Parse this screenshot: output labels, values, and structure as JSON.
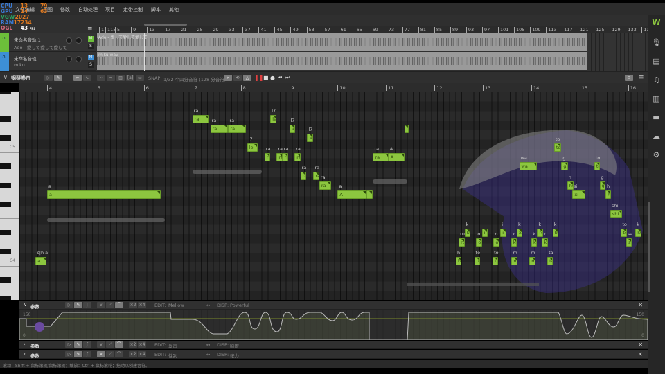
{
  "menu": [
    "文件",
    "编辑",
    "视图",
    "修改",
    "自动处理",
    "项目",
    "走带控制",
    "脚本",
    "其他"
  ],
  "stats": {
    "cpu_label": "CPU",
    "cpu": "13",
    "cpu_temp": "79",
    "gpu_label": "GPU",
    "gpu": "14",
    "gpu_temp": "63",
    "vram_label": "VGW",
    "vram": "2027",
    "ram_label": "RAM",
    "ram": "17234",
    "ogl_label": "OGL",
    "fps": "43",
    "fps_unit": "FPS"
  },
  "arrangement": {
    "ruler": [
      "1",
      "115",
      "5",
      "9",
      "13",
      "17",
      "21",
      "25",
      "29",
      "33",
      "37",
      "41",
      "45",
      "49",
      "53",
      "57",
      "61",
      "65",
      "69",
      "73",
      "77",
      "81",
      "85",
      "89",
      "93",
      "97",
      "101",
      "105",
      "109",
      "113",
      "117",
      "121",
      "125",
      "129",
      "133",
      "137"
    ],
    "tracks": [
      {
        "name": "未命名音轨 1",
        "sub": "Ado - 愛して愛して愛して",
        "clip": "Ado - 愛して愛して愛して",
        "color": "#6cbf3a",
        "mute": "M",
        "solo": "S"
      },
      {
        "name": "未命名音轨",
        "sub": "miku",
        "clip": "miku.wav",
        "color": "#3d8fd6",
        "mute": "M",
        "solo": "S"
      }
    ]
  },
  "piano_roll": {
    "title": "钢琴卷帘",
    "snap_label": "SNAP:",
    "snap_value": "1/32 个四分音符 (128 分音符)",
    "ruler": [
      "4",
      "5",
      "6",
      "7",
      "8",
      "9",
      "10",
      "11",
      "12",
      "13",
      "14",
      "15",
      "16"
    ],
    "key_labels": [
      "C5",
      "C4"
    ],
    "notes": [
      {
        "lyric": "a",
        "phoneme": "a",
        "bar": 4.0,
        "len": 2.34,
        "pitch": 67
      },
      {
        "lyric": "a",
        "phoneme": "c|h a",
        "bar": 3.76,
        "len": 0.23,
        "pitch": 60
      },
      {
        "lyric": "ra",
        "phoneme": "ra",
        "bar": 7.0,
        "len": 0.34,
        "pitch": 75
      },
      {
        "lyric": "ra",
        "phoneme": "ra",
        "bar": 7.37,
        "len": 0.37,
        "pitch": 74
      },
      {
        "lyric": "ra",
        "phoneme": "ra",
        "bar": 7.74,
        "len": 0.37,
        "pitch": 74
      },
      {
        "lyric": "le",
        "phoneme": "l7",
        "bar": 8.13,
        "len": 0.22,
        "pitch": 72
      },
      {
        "lyric": "ra",
        "phoneme": "ra",
        "bar": 8.49,
        "len": 0.12,
        "pitch": 71
      },
      {
        "lyric": "le",
        "phoneme": "l7",
        "bar": 8.61,
        "len": 0.12,
        "pitch": 75
      },
      {
        "lyric": "ra",
        "phoneme": "ra",
        "bar": 8.74,
        "len": 0.12,
        "pitch": 71
      },
      {
        "lyric": "ra",
        "phoneme": "ra",
        "bar": 8.86,
        "len": 0.12,
        "pitch": 71
      },
      {
        "lyric": "le",
        "phoneme": "l7",
        "bar": 9.0,
        "len": 0.12,
        "pitch": 74
      },
      {
        "lyric": "ra",
        "phoneme": "ra",
        "bar": 9.11,
        "len": 0.12,
        "pitch": 71
      },
      {
        "lyric": "ra",
        "phoneme": "ra",
        "bar": 9.23,
        "len": 0.12,
        "pitch": 69
      },
      {
        "lyric": "le",
        "phoneme": "l7",
        "bar": 9.37,
        "len": 0.12,
        "pitch": 73
      },
      {
        "lyric": "ra",
        "phoneme": "ra",
        "bar": 9.5,
        "len": 0.12,
        "pitch": 69
      },
      {
        "lyric": "ra",
        "phoneme": "ra",
        "bar": 9.62,
        "len": 0.24,
        "pitch": 68
      },
      {
        "lyric": "A",
        "phoneme": "a",
        "bar": 10.0,
        "len": 0.6,
        "pitch": 67
      },
      {
        "lyric": "-",
        "phoneme": "",
        "bar": 10.6,
        "len": 0.12,
        "pitch": 67
      },
      {
        "lyric": "ra",
        "phoneme": "ra",
        "bar": 10.73,
        "len": 0.32,
        "pitch": 71
      },
      {
        "lyric": "A",
        "phoneme": "A",
        "bar": 11.05,
        "len": 0.33,
        "pitch": 71
      },
      {
        "lyric": "l",
        "phoneme": "",
        "bar": 11.38,
        "len": 0.05,
        "pitch": 74
      },
      {
        "lyric": "hu",
        "phoneme": "h",
        "bar": 12.44,
        "len": 0.12,
        "pitch": 60
      },
      {
        "lyric": "ru",
        "phoneme": "ru",
        "bar": 12.5,
        "len": 0.12,
        "pitch": 62
      },
      {
        "lyric": "ku",
        "phoneme": "k",
        "bar": 12.62,
        "len": 0.12,
        "pitch": 63
      },
      {
        "lyric": "to",
        "phoneme": "to",
        "bar": 12.82,
        "len": 0.12,
        "pitch": 60
      },
      {
        "lyric": "o",
        "phoneme": "o",
        "bar": 12.86,
        "len": 0.12,
        "pitch": 62
      },
      {
        "lyric": "i",
        "phoneme": "i",
        "bar": 12.98,
        "len": 0.12,
        "pitch": 63
      },
      {
        "lyric": "to",
        "phoneme": "to",
        "bar": 13.2,
        "len": 0.12,
        "pitch": 60
      },
      {
        "lyric": "o",
        "phoneme": "o",
        "bar": 13.22,
        "len": 0.12,
        "pitch": 62
      },
      {
        "lyric": "i",
        "phoneme": "i",
        "bar": 13.36,
        "len": 0.12,
        "pitch": 63
      },
      {
        "lyric": "ka",
        "phoneme": "k",
        "bar": 13.58,
        "len": 0.12,
        "pitch": 62
      },
      {
        "lyric": "m",
        "phoneme": "m",
        "bar": 13.59,
        "len": 0.12,
        "pitch": 60
      },
      {
        "lyric": "xi",
        "phoneme": "k",
        "bar": 13.7,
        "len": 0.12,
        "pitch": 63
      },
      {
        "lyric": "wa",
        "phoneme": "wa",
        "bar": 13.75,
        "len": 0.36,
        "pitch": 70
      },
      {
        "lyric": "m",
        "phoneme": "m",
        "bar": 13.96,
        "len": 0.12,
        "pitch": 60
      },
      {
        "lyric": "ka",
        "phoneme": "k",
        "bar": 14.0,
        "len": 0.12,
        "pitch": 62
      },
      {
        "lyric": "re",
        "phoneme": "k",
        "bar": 14.12,
        "len": 0.12,
        "pitch": 63
      },
      {
        "lyric": "ku",
        "phoneme": "k",
        "bar": 14.22,
        "len": 0.12,
        "pitch": 62
      },
      {
        "lyric": "ta",
        "phoneme": "ta",
        "bar": 14.33,
        "len": 0.12,
        "pitch": 60
      },
      {
        "lyric": "bi",
        "phoneme": "k",
        "bar": 14.44,
        "len": 0.12,
        "pitch": 63
      },
      {
        "lyric": "to",
        "phoneme": "to",
        "bar": 14.47,
        "len": 0.14,
        "pitch": 72
      },
      {
        "lyric": "ga",
        "phoneme": "g",
        "bar": 14.62,
        "len": 0.14,
        "pitch": 70
      },
      {
        "lyric": "ho",
        "phoneme": "h",
        "bar": 14.74,
        "len": 0.13,
        "pitch": 68
      },
      {
        "lyric": "xi",
        "phoneme": "si",
        "bar": 14.85,
        "len": 0.26,
        "pitch": 67
      },
      {
        "lyric": "to",
        "phoneme": "to",
        "bar": 15.3,
        "len": 0.12,
        "pitch": 70
      },
      {
        "lyric": "ga",
        "phoneme": "g",
        "bar": 15.41,
        "len": 0.12,
        "pitch": 68
      },
      {
        "lyric": "ho",
        "phoneme": "h",
        "bar": 15.53,
        "len": 0.12,
        "pitch": 67
      },
      {
        "lyric": "shi",
        "phoneme": "shi",
        "bar": 15.63,
        "len": 0.24,
        "pitch": 65
      },
      {
        "lyric": "to",
        "phoneme": "to",
        "bar": 15.85,
        "len": 0.12,
        "pitch": 63
      },
      {
        "lyric": "sa",
        "phoneme": "sa",
        "bar": 15.96,
        "len": 0.12,
        "pitch": 62
      },
      {
        "lyric": "ko",
        "phoneme": "k",
        "bar": 16.15,
        "len": 0.12,
        "pitch": 63
      }
    ]
  },
  "params": {
    "main": {
      "title": "参数",
      "edit_label": "EDIT:",
      "edit": "Mellow",
      "disp_label": "DISP:",
      "disp": "Powerful",
      "max": "150",
      "min": "0",
      "x2": "×2",
      "x4": "×4"
    },
    "panel2": {
      "title": "参数",
      "edit_label": "EDIT:",
      "edit": "发声",
      "disp_label": "DISP:",
      "disp": "响度",
      "x2": "×2",
      "x4": "×4"
    },
    "panel3": {
      "title": "参数",
      "edit_label": "EDIT:",
      "edit": "性别",
      "disp_label": "DISP:",
      "disp": "张力",
      "x2": "×2",
      "x4": "×4"
    }
  },
  "status": "滚动：Shift + 鼠标滚轮/鼠标滚轮；缩放：Ctrl + 鼠标滚轮；拖动以创建音符。",
  "colors": {
    "note": "#8cc63f",
    "track1": "#6cbf3a",
    "track2": "#3d8fd6",
    "accent": "#e04040"
  }
}
